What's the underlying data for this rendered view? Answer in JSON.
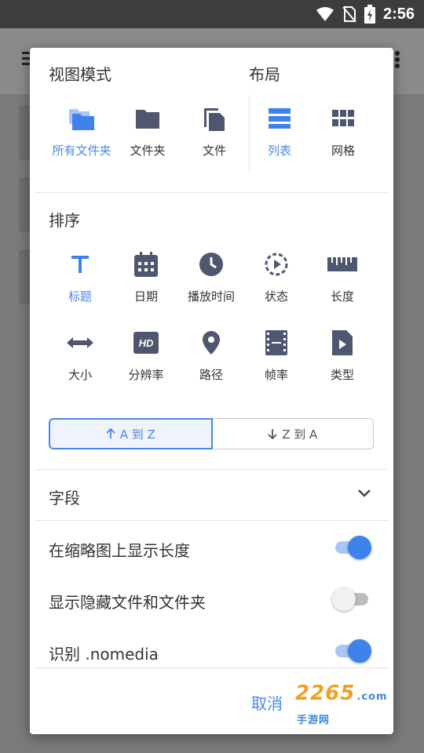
{
  "status": {
    "time": "2:56"
  },
  "view_mode": {
    "header": "视图模式",
    "options": [
      {
        "label": "所有文件夹",
        "icon": "folders-icon",
        "selected": true
      },
      {
        "label": "文件夹",
        "icon": "folder-icon",
        "selected": false
      },
      {
        "label": "文件",
        "icon": "file-copy-icon",
        "selected": false
      }
    ]
  },
  "layout": {
    "header": "布局",
    "options": [
      {
        "label": "列表",
        "icon": "list-icon",
        "selected": true
      },
      {
        "label": "网格",
        "icon": "grid-icon",
        "selected": false
      }
    ]
  },
  "sort": {
    "header": "排序",
    "options": [
      {
        "label": "标题",
        "icon": "title-icon",
        "selected": true
      },
      {
        "label": "日期",
        "icon": "calendar-icon",
        "selected": false
      },
      {
        "label": "播放时间",
        "icon": "clock-icon",
        "selected": false
      },
      {
        "label": "状态",
        "icon": "play-status-icon",
        "selected": false
      },
      {
        "label": "长度",
        "icon": "ruler-icon",
        "selected": false
      },
      {
        "label": "大小",
        "icon": "resize-icon",
        "selected": false
      },
      {
        "label": "分辨率",
        "icon": "hd-icon",
        "selected": false
      },
      {
        "label": "路径",
        "icon": "location-pin-icon",
        "selected": false
      },
      {
        "label": "帧率",
        "icon": "film-icon",
        "selected": false
      },
      {
        "label": "类型",
        "icon": "video-file-icon",
        "selected": false
      }
    ],
    "asc_label": "A 到 Z",
    "desc_label": "Z 到 A",
    "active": "asc"
  },
  "fields": {
    "label": "字段"
  },
  "settings": [
    {
      "label": "在缩略图上显示长度",
      "on": true
    },
    {
      "label": "显示隐藏文件和文件夹",
      "on": false
    },
    {
      "label": "识别 .nomedia",
      "on": true
    }
  ],
  "actions": {
    "cancel": "取消"
  },
  "watermark": {
    "text": "2265",
    "sub": ".com",
    "sub2": "手游网"
  },
  "colors": {
    "accent": "#4a86e8",
    "icon": "#4f5670"
  }
}
